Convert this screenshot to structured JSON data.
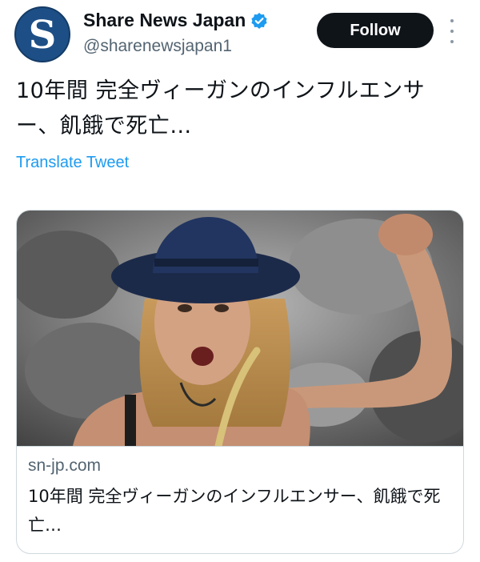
{
  "account": {
    "avatar_letter": "S",
    "display_name": "Share News Japan",
    "handle": "@sharenewsjapan1",
    "verified_icon": "verified-badge-icon",
    "follow_label": "Follow",
    "more_icon": "more-vertical-icon"
  },
  "tweet": {
    "text": "10年間 完全ヴィーガンのインフルエンサー、飢餓で死亡…",
    "translate_label": "Translate Tweet"
  },
  "card": {
    "image_icon": "article-photo",
    "domain": "sn-jp.com",
    "title": "10年間 完全ヴィーガンのインフルエンサー、飢餓で死亡…"
  },
  "colors": {
    "accent": "#1d9bf0",
    "follow_bg": "#0f1419",
    "avatar_bg": "#1d4f86",
    "text_primary": "#0f1419",
    "text_secondary": "#536471"
  }
}
